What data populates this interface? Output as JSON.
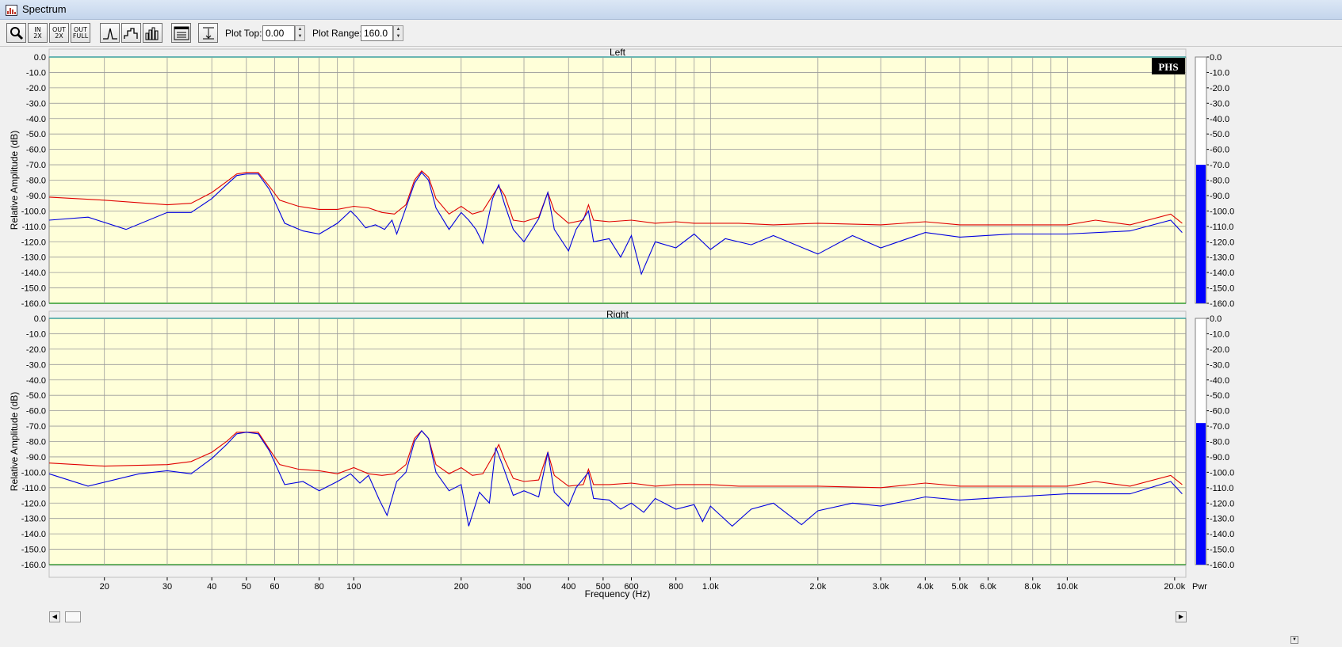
{
  "window": {
    "title": "Spectrum"
  },
  "toolbar": {
    "zoom_in_x2": {
      "top": "IN",
      "bottom": "2X"
    },
    "zoom_out_x2": {
      "top": "OUT",
      "bottom": "2X"
    },
    "zoom_out_full": {
      "top": "OUT",
      "bottom": "FULL"
    },
    "plot_top_label": "Plot Top:",
    "plot_top_value": "0.00",
    "plot_range_label": "Plot Range:",
    "plot_range_value": "160.0"
  },
  "badge": "PHS",
  "pwr_label": "Pwr",
  "x_axis": {
    "label": "Frequency (Hz)",
    "scale": "log",
    "range": [
      14,
      21500
    ],
    "ticks": [
      {
        "value": 20,
        "label": "20"
      },
      {
        "value": 30,
        "label": "30"
      },
      {
        "value": 40,
        "label": "40"
      },
      {
        "value": 50,
        "label": "50"
      },
      {
        "value": 60,
        "label": "60"
      },
      {
        "value": 80,
        "label": "80"
      },
      {
        "value": 100,
        "label": "100"
      },
      {
        "value": 200,
        "label": "200"
      },
      {
        "value": 300,
        "label": "300"
      },
      {
        "value": 400,
        "label": "400"
      },
      {
        "value": 500,
        "label": "500"
      },
      {
        "value": 600,
        "label": "600"
      },
      {
        "value": 800,
        "label": "800"
      },
      {
        "value": 1000,
        "label": "1.0k"
      },
      {
        "value": 2000,
        "label": "2.0k"
      },
      {
        "value": 3000,
        "label": "3.0k"
      },
      {
        "value": 4000,
        "label": "4.0k"
      },
      {
        "value": 5000,
        "label": "5.0k"
      },
      {
        "value": 6000,
        "label": "6.0k"
      },
      {
        "value": 8000,
        "label": "8.0k"
      },
      {
        "value": 10000,
        "label": "10.0k"
      },
      {
        "value": 20000,
        "label": "20.0k"
      }
    ]
  },
  "y_axis": {
    "label": "Relative Amplitude (dB)",
    "range": [
      -160,
      0
    ],
    "tick_labels": [
      "0.0",
      "-10.0",
      "-20.0",
      "-30.0",
      "-40.0",
      "-50.0",
      "-60.0",
      "-70.0",
      "-80.0",
      "-90.0",
      "-100.0",
      "-110.0",
      "-120.0",
      "-130.0",
      "-140.0",
      "-150.0",
      "-160.0"
    ]
  },
  "colors": {
    "plot_bg": "#ffffd9",
    "grid": "#9a9a9a",
    "series_peak": "#e00000",
    "series_current": "#0000e0",
    "meter_fill": "#0000ff",
    "top_border": "#3aa0a0",
    "bottom_border": "#2e9a2e"
  },
  "chart_data": [
    {
      "type": "line",
      "title": "Left",
      "xscale": "log",
      "xlim": [
        14,
        21500
      ],
      "ylim": [
        -160,
        0
      ],
      "meter_level": -70,
      "series": [
        {
          "color": "#e00000",
          "points": [
            [
              14,
              -91
            ],
            [
              20,
              -93
            ],
            [
              30,
              -96
            ],
            [
              35,
              -95
            ],
            [
              40,
              -88
            ],
            [
              44,
              -81
            ],
            [
              47,
              -76
            ],
            [
              50,
              -75
            ],
            [
              54,
              -75
            ],
            [
              58,
              -84
            ],
            [
              62,
              -93
            ],
            [
              70,
              -97
            ],
            [
              80,
              -99
            ],
            [
              90,
              -99
            ],
            [
              100,
              -97
            ],
            [
              110,
              -98
            ],
            [
              120,
              -101
            ],
            [
              130,
              -102
            ],
            [
              140,
              -96
            ],
            [
              148,
              -80
            ],
            [
              155,
              -74
            ],
            [
              162,
              -78
            ],
            [
              170,
              -92
            ],
            [
              185,
              -102
            ],
            [
              200,
              -97
            ],
            [
              215,
              -102
            ],
            [
              230,
              -100
            ],
            [
              245,
              -90
            ],
            [
              255,
              -84
            ],
            [
              265,
              -90
            ],
            [
              280,
              -106
            ],
            [
              300,
              -107
            ],
            [
              330,
              -104
            ],
            [
              350,
              -88
            ],
            [
              365,
              -100
            ],
            [
              400,
              -108
            ],
            [
              440,
              -106
            ],
            [
              455,
              -96
            ],
            [
              470,
              -106
            ],
            [
              520,
              -107
            ],
            [
              600,
              -106
            ],
            [
              700,
              -108
            ],
            [
              800,
              -107
            ],
            [
              900,
              -108
            ],
            [
              1000,
              -108
            ],
            [
              1200,
              -108
            ],
            [
              1500,
              -109
            ],
            [
              2000,
              -108
            ],
            [
              3000,
              -109
            ],
            [
              4000,
              -107
            ],
            [
              5000,
              -109
            ],
            [
              7000,
              -109
            ],
            [
              10000,
              -109
            ],
            [
              12000,
              -106
            ],
            [
              15000,
              -109
            ],
            [
              19500,
              -102
            ],
            [
              21000,
              -108
            ]
          ]
        },
        {
          "color": "#0000e0",
          "points": [
            [
              14,
              -106
            ],
            [
              18,
              -104
            ],
            [
              23,
              -112
            ],
            [
              30,
              -101
            ],
            [
              35,
              -101
            ],
            [
              40,
              -92
            ],
            [
              44,
              -83
            ],
            [
              47,
              -77
            ],
            [
              50,
              -76
            ],
            [
              54,
              -76
            ],
            [
              58,
              -86
            ],
            [
              64,
              -108
            ],
            [
              72,
              -113
            ],
            [
              80,
              -115
            ],
            [
              90,
              -108
            ],
            [
              98,
              -100
            ],
            [
              102,
              -104
            ],
            [
              108,
              -111
            ],
            [
              115,
              -109
            ],
            [
              122,
              -112
            ],
            [
              128,
              -106
            ],
            [
              132,
              -115
            ],
            [
              140,
              -98
            ],
            [
              148,
              -82
            ],
            [
              155,
              -75
            ],
            [
              162,
              -80
            ],
            [
              170,
              -98
            ],
            [
              185,
              -112
            ],
            [
              200,
              -101
            ],
            [
              210,
              -106
            ],
            [
              220,
              -112
            ],
            [
              230,
              -121
            ],
            [
              245,
              -92
            ],
            [
              255,
              -83
            ],
            [
              265,
              -96
            ],
            [
              280,
              -112
            ],
            [
              300,
              -120
            ],
            [
              330,
              -105
            ],
            [
              350,
              -88
            ],
            [
              365,
              -112
            ],
            [
              400,
              -126
            ],
            [
              420,
              -112
            ],
            [
              455,
              -100
            ],
            [
              470,
              -120
            ],
            [
              520,
              -118
            ],
            [
              560,
              -130
            ],
            [
              600,
              -116
            ],
            [
              640,
              -141
            ],
            [
              700,
              -120
            ],
            [
              800,
              -124
            ],
            [
              900,
              -115
            ],
            [
              1000,
              -125
            ],
            [
              1100,
              -118
            ],
            [
              1300,
              -122
            ],
            [
              1500,
              -116
            ],
            [
              2000,
              -128
            ],
            [
              2500,
              -116
            ],
            [
              3000,
              -124
            ],
            [
              4000,
              -114
            ],
            [
              5000,
              -117
            ],
            [
              7000,
              -115
            ],
            [
              10000,
              -115
            ],
            [
              15000,
              -113
            ],
            [
              19500,
              -106
            ],
            [
              21000,
              -114
            ]
          ]
        }
      ]
    },
    {
      "type": "line",
      "title": "Right",
      "xscale": "log",
      "xlim": [
        14,
        21500
      ],
      "ylim": [
        -160,
        0
      ],
      "meter_level": -68,
      "series": [
        {
          "color": "#e00000",
          "points": [
            [
              14,
              -94
            ],
            [
              20,
              -96
            ],
            [
              30,
              -95
            ],
            [
              35,
              -93
            ],
            [
              40,
              -87
            ],
            [
              44,
              -80
            ],
            [
              47,
              -74
            ],
            [
              50,
              -74
            ],
            [
              54,
              -74
            ],
            [
              58,
              -85
            ],
            [
              62,
              -95
            ],
            [
              70,
              -98
            ],
            [
              80,
              -99
            ],
            [
              90,
              -101
            ],
            [
              100,
              -97
            ],
            [
              110,
              -101
            ],
            [
              120,
              -102
            ],
            [
              130,
              -101
            ],
            [
              140,
              -95
            ],
            [
              148,
              -78
            ],
            [
              155,
              -73
            ],
            [
              162,
              -78
            ],
            [
              170,
              -95
            ],
            [
              185,
              -101
            ],
            [
              200,
              -97
            ],
            [
              215,
              -102
            ],
            [
              230,
              -101
            ],
            [
              245,
              -90
            ],
            [
              255,
              -82
            ],
            [
              265,
              -92
            ],
            [
              280,
              -104
            ],
            [
              300,
              -106
            ],
            [
              330,
              -105
            ],
            [
              350,
              -87
            ],
            [
              365,
              -102
            ],
            [
              400,
              -109
            ],
            [
              440,
              -108
            ],
            [
              455,
              -98
            ],
            [
              470,
              -108
            ],
            [
              520,
              -108
            ],
            [
              600,
              -107
            ],
            [
              700,
              -109
            ],
            [
              800,
              -108
            ],
            [
              900,
              -108
            ],
            [
              1000,
              -108
            ],
            [
              1200,
              -109
            ],
            [
              1500,
              -109
            ],
            [
              2000,
              -109
            ],
            [
              3000,
              -110
            ],
            [
              4000,
              -107
            ],
            [
              5000,
              -109
            ],
            [
              7000,
              -109
            ],
            [
              10000,
              -109
            ],
            [
              12000,
              -106
            ],
            [
              15000,
              -109
            ],
            [
              19500,
              -102
            ],
            [
              21000,
              -108
            ]
          ]
        },
        {
          "color": "#0000e0",
          "points": [
            [
              14,
              -101
            ],
            [
              18,
              -109
            ],
            [
              25,
              -101
            ],
            [
              30,
              -99
            ],
            [
              35,
              -101
            ],
            [
              40,
              -91
            ],
            [
              44,
              -82
            ],
            [
              47,
              -75
            ],
            [
              50,
              -74
            ],
            [
              54,
              -75
            ],
            [
              58,
              -86
            ],
            [
              64,
              -108
            ],
            [
              72,
              -106
            ],
            [
              80,
              -112
            ],
            [
              90,
              -106
            ],
            [
              98,
              -101
            ],
            [
              104,
              -107
            ],
            [
              110,
              -102
            ],
            [
              118,
              -118
            ],
            [
              124,
              -128
            ],
            [
              132,
              -106
            ],
            [
              140,
              -100
            ],
            [
              148,
              -80
            ],
            [
              155,
              -73
            ],
            [
              162,
              -78
            ],
            [
              170,
              -100
            ],
            [
              185,
              -112
            ],
            [
              200,
              -108
            ],
            [
              210,
              -135
            ],
            [
              225,
              -113
            ],
            [
              240,
              -120
            ],
            [
              250,
              -84
            ],
            [
              262,
              -96
            ],
            [
              280,
              -115
            ],
            [
              300,
              -112
            ],
            [
              330,
              -116
            ],
            [
              350,
              -87
            ],
            [
              365,
              -113
            ],
            [
              400,
              -122
            ],
            [
              420,
              -110
            ],
            [
              455,
              -100
            ],
            [
              470,
              -117
            ],
            [
              520,
              -118
            ],
            [
              560,
              -124
            ],
            [
              600,
              -120
            ],
            [
              650,
              -126
            ],
            [
              700,
              -117
            ],
            [
              800,
              -124
            ],
            [
              900,
              -121
            ],
            [
              950,
              -132
            ],
            [
              1000,
              -122
            ],
            [
              1150,
              -135
            ],
            [
              1300,
              -124
            ],
            [
              1500,
              -120
            ],
            [
              1800,
              -134
            ],
            [
              2000,
              -125
            ],
            [
              2500,
              -120
            ],
            [
              3000,
              -122
            ],
            [
              4000,
              -116
            ],
            [
              5000,
              -118
            ],
            [
              7000,
              -116
            ],
            [
              10000,
              -114
            ],
            [
              15000,
              -114
            ],
            [
              19500,
              -106
            ],
            [
              21000,
              -114
            ]
          ]
        }
      ]
    }
  ]
}
